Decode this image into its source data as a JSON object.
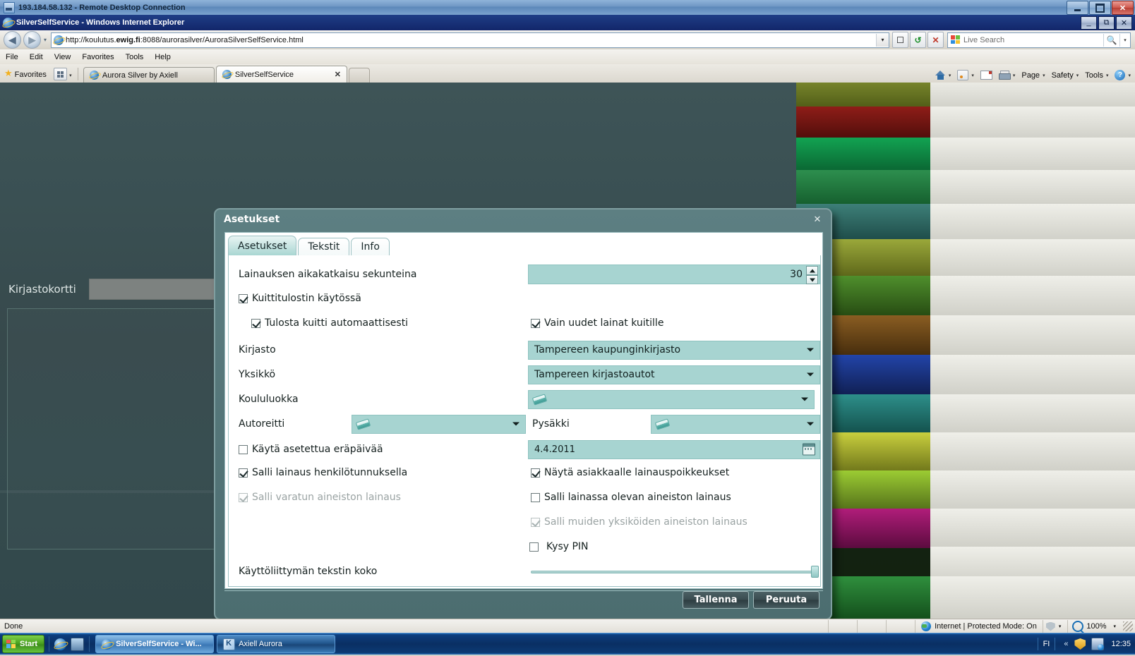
{
  "rdp": {
    "title": "193.184.58.132 - Remote Desktop Connection",
    "icon": "remote-desktop-icon",
    "minimize": "–",
    "restore": "❐",
    "close": "✕"
  },
  "browser": {
    "title": "SilverSelfService - Windows Internet Explorer",
    "minimize": "_",
    "restore": "❐",
    "close": "✕",
    "address": {
      "url_prefix": "http://koulutus.",
      "url_bold": "ewig.fi",
      "url_suffix": ":8088/aurorasilver/AuroraSilverSelfService.html",
      "dropdown_caret": "▾"
    },
    "nav": {
      "back": "◀",
      "forward": "▶",
      "recent_caret": "▾",
      "compat_view": "compatibility-view-icon",
      "refresh": "refresh-icon",
      "stop": "stop-icon"
    },
    "search": {
      "placeholder": "Live Search",
      "go": "⌕",
      "caret": "▾"
    },
    "menu": [
      "File",
      "Edit",
      "View",
      "Favorites",
      "Tools",
      "Help"
    ],
    "favorites": {
      "star": "★",
      "label": "Favorites",
      "grid_caret": "▾"
    },
    "tabs": [
      {
        "label": "Aurora Silver by Axiell",
        "active": false,
        "close": ""
      },
      {
        "label": "SilverSelfService",
        "active": true,
        "close": "✕"
      }
    ],
    "commands": [
      {
        "name": "home",
        "label": "",
        "caret": "▾"
      },
      {
        "name": "feeds",
        "label": "",
        "caret": "▾"
      },
      {
        "name": "mail",
        "label": "",
        "caret": ""
      },
      {
        "name": "print",
        "label": "",
        "caret": "▾"
      },
      {
        "name": "page",
        "label": "Page",
        "caret": "▾"
      },
      {
        "name": "safety",
        "label": "Safety",
        "caret": "▾"
      },
      {
        "name": "tools",
        "label": "Tools",
        "caret": "▾"
      },
      {
        "name": "help",
        "label": "",
        "caret": "▾"
      }
    ],
    "status": {
      "text": "Done",
      "zone": "Internet | Protected Mode: On",
      "zone_caret": "▾",
      "zoom": "100%",
      "zoom_caret": "▾"
    }
  },
  "page": {
    "library_card_label": "Kirjastokortti",
    "library_card_value": ""
  },
  "dialog": {
    "title": "Asetukset",
    "close": "✕",
    "tabs": [
      {
        "label": "Asetukset",
        "selected": true
      },
      {
        "label": "Tekstit",
        "selected": false
      },
      {
        "label": "Info",
        "selected": false
      }
    ],
    "fields": {
      "timeout_label": "Lainauksen aikakatkaisu sekunteina",
      "timeout_value": "30",
      "receipt_printer": {
        "label": "Kuittitulostin käytössä",
        "checked": true,
        "enabled": true
      },
      "print_auto": {
        "label": "Tulosta kuitti automaattisesti",
        "checked": true,
        "enabled": true
      },
      "only_new_loans": {
        "label": "Vain uudet lainat kuitille",
        "checked": true,
        "enabled": true
      },
      "library_label": "Kirjasto",
      "library_value": "Tampereen kaupunginkirjasto",
      "unit_label": "Yksikkö",
      "unit_value": "Tampereen kirjastoautot",
      "schoolclass_label": "Koululuokka",
      "schoolclass_value": "",
      "route_label": "Autoreitti",
      "route_value": "",
      "stop_label": "Pysäkki",
      "stop_value": "",
      "use_duedate": {
        "label": "Käytä asetettua eräpäivää",
        "checked": false,
        "enabled": true
      },
      "duedate_value": "4.4.2011",
      "allow_ssn": {
        "label": "Salli lainaus henkilötunnuksella",
        "checked": true,
        "enabled": true
      },
      "show_exceptions": {
        "label": "Näytä asiakkaalle lainauspoikkeukset",
        "checked": true,
        "enabled": true
      },
      "allow_reserved": {
        "label": "Salli varatun aineiston lainaus",
        "checked": true,
        "enabled": false
      },
      "allow_onloan": {
        "label": "Salli lainassa olevan aineiston lainaus",
        "checked": false,
        "enabled": true
      },
      "allow_other_units": {
        "label": "Salli muiden yksiköiden aineiston lainaus",
        "checked": true,
        "enabled": false
      },
      "ask_pin": {
        "label": "Kysy PIN",
        "checked": false,
        "enabled": true
      },
      "textsize_label": "Käyttöliittymän tekstin koko",
      "textsize_percent": 100
    },
    "buttons": {
      "save": "Tallenna",
      "cancel": "Peruuta"
    },
    "icons": {
      "clear": "eraser-icon",
      "calendar": "calendar-icon",
      "dropdown_caret": "▾"
    }
  },
  "taskbar": {
    "start": "Start",
    "quicklaunch": [
      "internet-explorer-icon",
      "show-desktop-icon"
    ],
    "items": [
      {
        "label": "SilverSelfService - Wi...",
        "icon": "internet-explorer-icon",
        "active": true
      },
      {
        "label": "Axiell Aurora",
        "icon": "axiell-aurora-icon",
        "active": false
      }
    ],
    "tray": {
      "language": "FI",
      "chevron": "«",
      "icons": [
        "security-shield-icon",
        "network-icon"
      ],
      "clock": "12:35"
    }
  },
  "colors": {
    "accent_teal": "#a7d4d1",
    "dialog_chrome": "#5d7f82",
    "desktop_teal": "#3a5053",
    "taskbar_blue": "#0a2f63",
    "tab_selected": "#a9d6d2"
  }
}
